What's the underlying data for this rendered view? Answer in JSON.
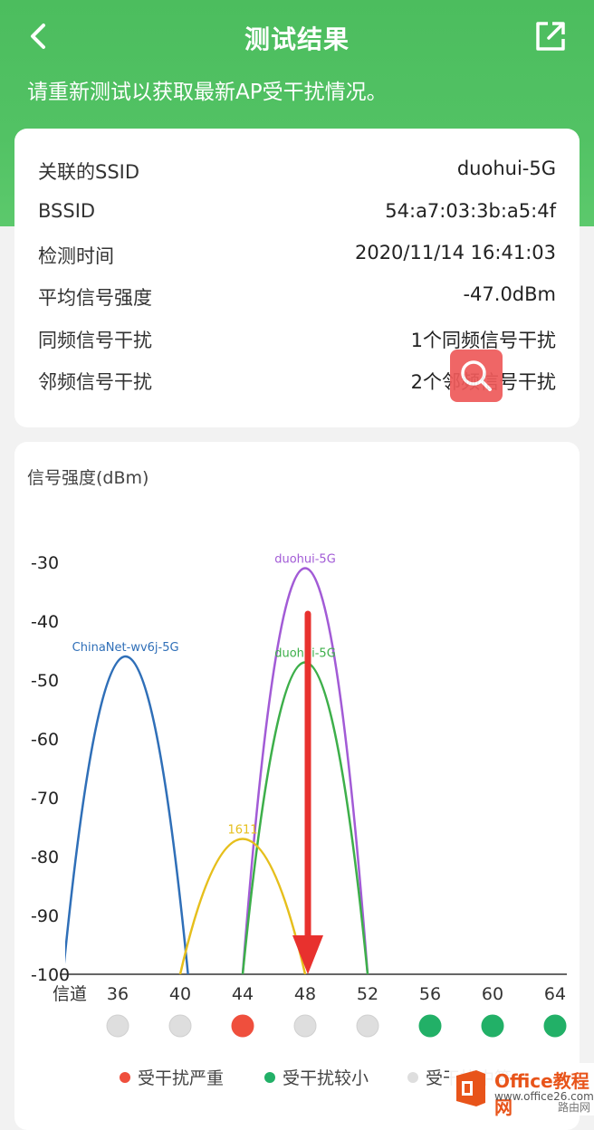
{
  "header": {
    "title": "测试结果",
    "notice": "请重新测试以获取最新AP受干扰情况。"
  },
  "info": {
    "rows": [
      {
        "label": "关联的SSID",
        "value": "duohui-5G"
      },
      {
        "label": "BSSID",
        "value": "54:a7:03:3b:a5:4f"
      },
      {
        "label": "检测时间",
        "value": "2020/11/14 16:41:03"
      },
      {
        "label": "平均信号强度",
        "value": "-47.0dBm"
      },
      {
        "label": "同频信号干扰",
        "value": "1个同频信号干扰"
      },
      {
        "label": "邻频信号干扰",
        "value": "2个邻频信号干扰"
      }
    ]
  },
  "legend": {
    "severe": "受干扰严重",
    "low": "受干扰较小",
    "medium": "受干扰中等"
  },
  "watermark": {
    "brand": "Office教程网",
    "url": "www.office26.com",
    "site": "路由网"
  },
  "chart_data": {
    "type": "line",
    "ylabel": "信号强度(dBm)",
    "xlabel": "信道",
    "ylim": [
      -100,
      -30
    ],
    "yticks": [
      -30,
      -40,
      -50,
      -60,
      -70,
      -80,
      -90,
      -100
    ],
    "x": [
      36,
      40,
      44,
      48,
      52,
      56,
      60,
      64
    ],
    "series": [
      {
        "name": "ChinaNet-wv6j-5G",
        "center": 36.5,
        "peak": -46,
        "color": "#2f6fb8"
      },
      {
        "name": "duohui-5G",
        "center": 48,
        "peak": -31,
        "color": "#a25bd6"
      },
      {
        "name": "duohui-5G",
        "center": 48,
        "peak": -47,
        "color": "#3daf4a"
      },
      {
        "name": "1611",
        "center": 44,
        "peak": -77,
        "color": "#e6bf1c"
      }
    ],
    "channel_status": [
      "medium",
      "medium",
      "severe",
      "medium",
      "medium",
      "low",
      "low",
      "low"
    ],
    "status_colors": {
      "severe": "#ef4f3d",
      "low": "#22b067",
      "medium": "#dedede"
    },
    "grid": false
  }
}
